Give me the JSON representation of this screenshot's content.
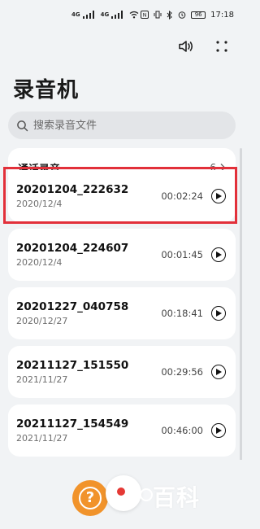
{
  "status_bar": {
    "net1": "4G",
    "net2": "4G",
    "battery": "96",
    "time": "17:18"
  },
  "header": {
    "title": "录音机",
    "speaker_icon": "speaker-icon",
    "more_icon": "more-dots-icon"
  },
  "search": {
    "placeholder": "搜索录音文件",
    "value": ""
  },
  "call_recordings": {
    "label": "通话录音",
    "count": "6"
  },
  "recordings": [
    {
      "name": "20201204_222632",
      "date": "2020/12/4",
      "duration": "00:02:24"
    },
    {
      "name": "20201204_224607",
      "date": "2020/12/4",
      "duration": "00:01:45"
    },
    {
      "name": "20201227_040758",
      "date": "2020/12/27",
      "duration": "00:18:41"
    },
    {
      "name": "20211127_151550",
      "date": "2021/11/27",
      "duration": "00:29:56"
    },
    {
      "name": "20211127_154549",
      "date": "2021/11/27",
      "duration": "00:46:00"
    }
  ],
  "bottom": {
    "help_icon": "?",
    "watermark": "百科"
  },
  "colors": {
    "highlight": "#e2303a",
    "help": "#f1932b",
    "record": "#e53935"
  }
}
